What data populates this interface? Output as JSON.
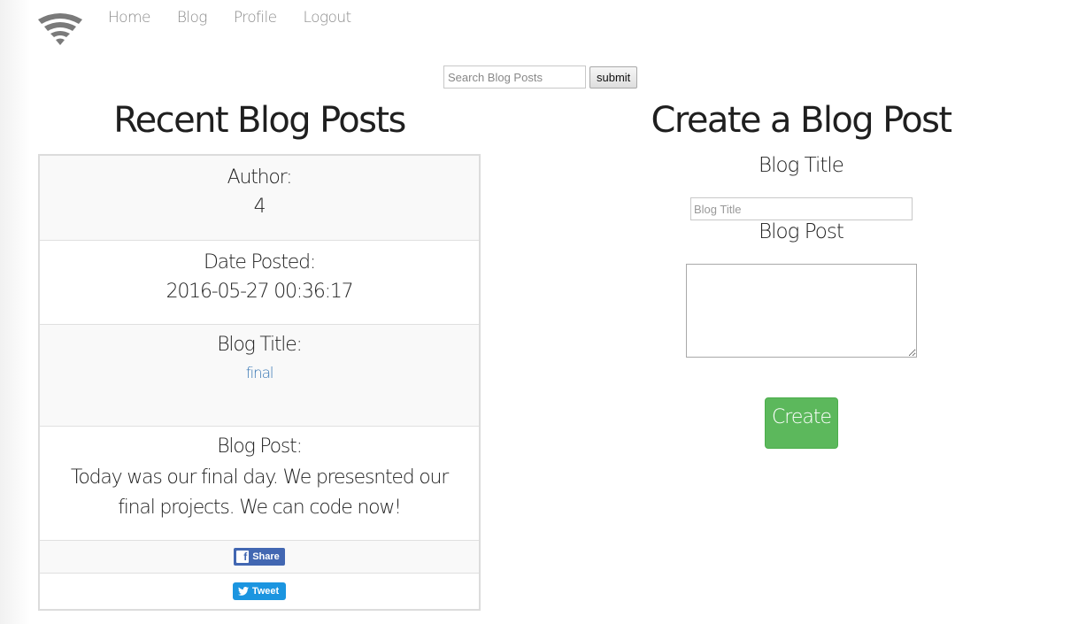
{
  "nav": {
    "items": [
      {
        "label": "Home"
      },
      {
        "label": "Blog"
      },
      {
        "label": "Profile"
      },
      {
        "label": "Logout"
      }
    ]
  },
  "search": {
    "placeholder": "Search Blog Posts",
    "submit_label": "submit"
  },
  "recent": {
    "title": "Recent Blog Posts",
    "post": {
      "author_label": "Author:",
      "author_value": "4",
      "date_label": "Date Posted:",
      "date_value": "2016-05-27 00:36:17",
      "title_label": "Blog Title:",
      "title_value": "final",
      "post_label": "Blog Post:",
      "post_value": "Today was our final day. We presesnted our final projects. We can code now!",
      "share_label": "Share",
      "tweet_label": "Tweet"
    }
  },
  "create": {
    "title": "Create a Blog Post",
    "blog_title_label": "Blog Title",
    "blog_title_placeholder": "Blog Title",
    "blog_post_label": "Blog Post",
    "create_label": "Create"
  },
  "colors": {
    "create_button": "#5cb85c",
    "link": "#3a78b5",
    "facebook": "#4267b2",
    "twitter": "#1b95e0",
    "nav_text": "#8a8a8a"
  },
  "icons": {
    "logo": "wifi-icon",
    "facebook": "facebook-icon",
    "twitter": "twitter-icon"
  }
}
